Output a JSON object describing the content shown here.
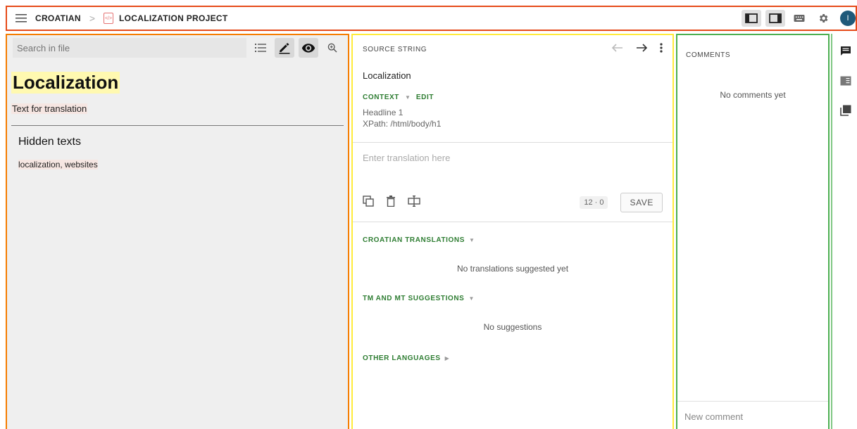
{
  "topbar": {
    "breadcrumb_language": "CROATIAN",
    "breadcrumb_sep": ">",
    "breadcrumb_project": "LOCALIZATION PROJECT",
    "avatar_initial": "I"
  },
  "editor": {
    "search_placeholder": "Search in file",
    "heading": "Localization",
    "subtext": "Text for translation",
    "hidden_title": "Hidden texts",
    "hidden_value": "localization, websites"
  },
  "source": {
    "section_label": "SOURCE STRING",
    "text": "Localization",
    "context_label": "CONTEXT",
    "edit_label": "EDIT",
    "context_lines": [
      "Headline 1",
      "XPath: /html/body/h1"
    ],
    "translation_placeholder": "Enter translation here",
    "char_count": "12 · 0",
    "save_label": "SAVE",
    "translations_label": "CROATIAN TRANSLATIONS",
    "translations_empty": "No translations suggested yet",
    "suggestions_label": "TM AND MT SUGGESTIONS",
    "suggestions_empty": "No suggestions",
    "other_languages_label": "OTHER LANGUAGES"
  },
  "comments": {
    "title": "COMMENTS",
    "empty": "No comments yet",
    "new_placeholder": "New comment"
  },
  "colors": {
    "accent_green": "#2e7d32",
    "border_top": "#e64a19",
    "border_left": "#f57c00",
    "border_mid": "#ffeb3b",
    "border_right": "#4caf50",
    "avatar": "#1f5a7a"
  }
}
